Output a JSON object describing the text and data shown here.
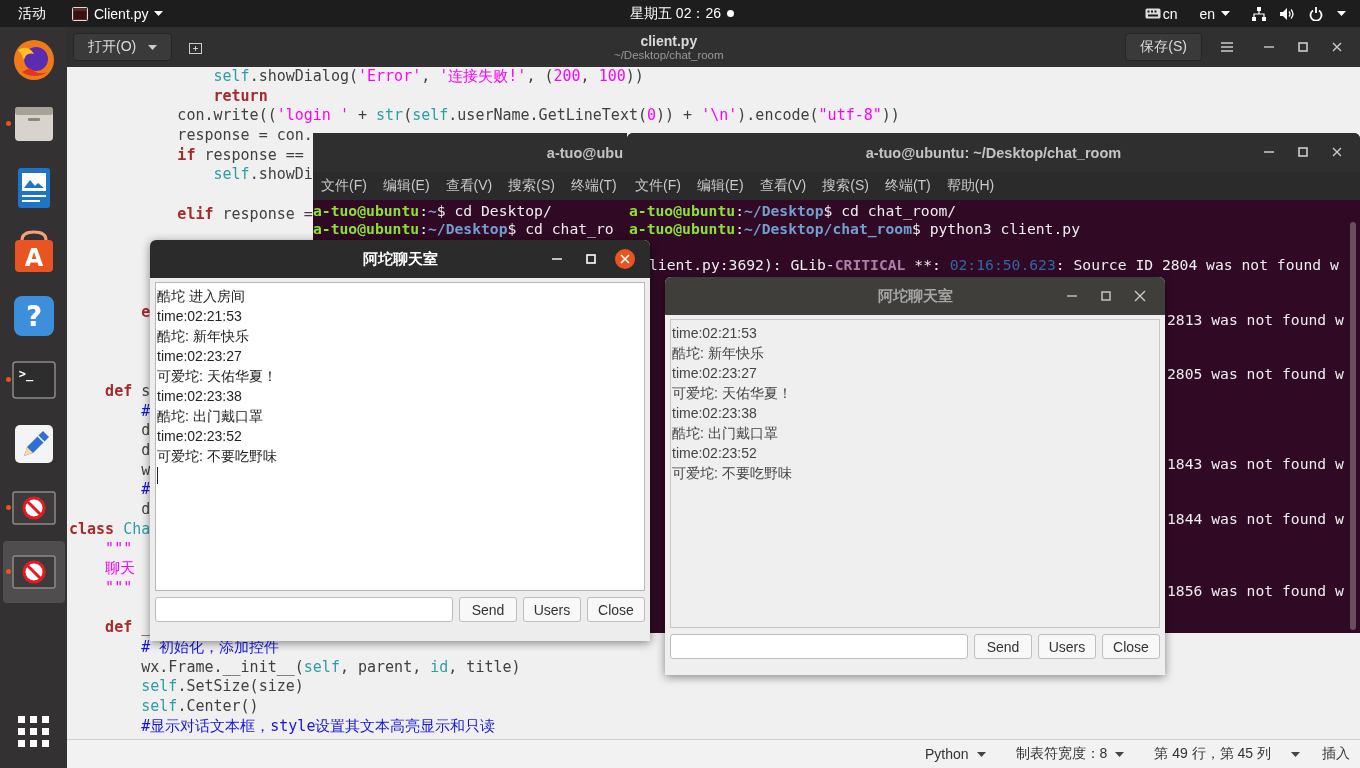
{
  "top_bar": {
    "activities": "活动",
    "app_menu": "Client.py",
    "clock": "星期五 02：26",
    "keyboard": "cn",
    "language": "en"
  },
  "dock": {
    "items": [
      {
        "kind": "browser",
        "running": false,
        "selected": false
      },
      {
        "kind": "files",
        "running": true,
        "selected": false
      },
      {
        "kind": "writer",
        "running": false,
        "selected": false
      },
      {
        "kind": "software",
        "glyph": "A",
        "running": false,
        "selected": false
      },
      {
        "kind": "help",
        "glyph": "?",
        "running": false,
        "selected": false
      },
      {
        "kind": "terminal",
        "glyph": ">_",
        "running": true,
        "selected": false
      },
      {
        "kind": "editor",
        "running": false,
        "selected": false
      },
      {
        "kind": "app",
        "running": true,
        "selected": false
      },
      {
        "kind": "app",
        "running": true,
        "selected": true
      }
    ]
  },
  "editor": {
    "open_button": "打开(O)",
    "title": "client.py",
    "subtitle": "~/Desktop/chat_room",
    "save_button": "保存(S)",
    "lines": [
      {
        "kind": "code",
        "segments": [
          {
            "kind": "self",
            "text": "                self"
          },
          {
            "kind": "plain",
            "text": ".showDialog("
          },
          {
            "kind": "str",
            "text": "'Error'"
          },
          {
            "kind": "plain",
            "text": ", "
          },
          {
            "kind": "str",
            "text": "'连接失败!'"
          },
          {
            "kind": "plain",
            "text": ", ("
          },
          {
            "kind": "num",
            "text": "200"
          },
          {
            "kind": "plain",
            "text": ", "
          },
          {
            "kind": "num",
            "text": "100"
          },
          {
            "kind": "plain",
            "text": "))"
          }
        ]
      },
      {
        "kind": "code",
        "segments": [
          {
            "kind": "kw",
            "text": "                return"
          }
        ]
      },
      {
        "kind": "code",
        "segments": [
          {
            "kind": "plain",
            "text": "            con.write(("
          },
          {
            "kind": "str",
            "text": "'login '"
          },
          {
            "kind": "plain",
            "text": " + "
          },
          {
            "kind": "builtin",
            "text": "str"
          },
          {
            "kind": "plain",
            "text": "("
          },
          {
            "kind": "self",
            "text": "self"
          },
          {
            "kind": "plain",
            "text": ".userName.GetLineText("
          },
          {
            "kind": "num",
            "text": "0"
          },
          {
            "kind": "plain",
            "text": ")) + "
          },
          {
            "kind": "str",
            "text": "'\\n'"
          },
          {
            "kind": "plain",
            "text": ").encode("
          },
          {
            "kind": "str",
            "text": "\"utf-8\""
          },
          {
            "kind": "plain",
            "text": "))"
          }
        ]
      },
      {
        "kind": "code",
        "segments": [
          {
            "kind": "plain",
            "text": "            response = con."
          }
        ]
      },
      {
        "kind": "code",
        "segments": [
          {
            "kind": "kw",
            "text": "            if"
          },
          {
            "kind": "plain",
            "text": " response =="
          }
        ]
      },
      {
        "kind": "code",
        "segments": [
          {
            "kind": "self",
            "text": "                self"
          },
          {
            "kind": "plain",
            "text": ".showDi"
          }
        ]
      },
      {
        "kind": "blank"
      },
      {
        "kind": "code",
        "segments": [
          {
            "kind": "kw",
            "text": "            elif"
          },
          {
            "kind": "plain",
            "text": " response ="
          }
        ]
      },
      {
        "kind": "blank"
      },
      {
        "kind": "blank"
      },
      {
        "kind": "blank"
      },
      {
        "kind": "blank"
      },
      {
        "kind": "code",
        "segments": [
          {
            "kind": "kw",
            "text": "        e"
          }
        ]
      },
      {
        "kind": "blank"
      },
      {
        "kind": "blank"
      },
      {
        "kind": "blank"
      },
      {
        "kind": "code",
        "segments": [
          {
            "kind": "kw",
            "text": "    def"
          },
          {
            "kind": "plain",
            "text": " s"
          }
        ]
      },
      {
        "kind": "code",
        "segments": [
          {
            "kind": "cmt",
            "text": "        #"
          }
        ]
      },
      {
        "kind": "code",
        "segments": [
          {
            "kind": "plain",
            "text": "        d"
          }
        ]
      },
      {
        "kind": "code",
        "segments": [
          {
            "kind": "plain",
            "text": "        d"
          }
        ]
      },
      {
        "kind": "code",
        "segments": [
          {
            "kind": "plain",
            "text": "        w"
          }
        ]
      },
      {
        "kind": "code",
        "segments": [
          {
            "kind": "cmt",
            "text": "        #"
          }
        ]
      },
      {
        "kind": "code",
        "segments": [
          {
            "kind": "plain",
            "text": "        d"
          }
        ]
      },
      {
        "kind": "code",
        "segments": [
          {
            "kind": "kw",
            "text": "class"
          },
          {
            "kind": "self",
            "text": " Cha"
          }
        ]
      },
      {
        "kind": "code",
        "segments": [
          {
            "kind": "str",
            "text": "    \"\"\""
          }
        ]
      },
      {
        "kind": "code",
        "segments": [
          {
            "kind": "str",
            "text": "    聊天"
          }
        ]
      },
      {
        "kind": "code",
        "segments": [
          {
            "kind": "str",
            "text": "    \"\"\""
          }
        ]
      },
      {
        "kind": "blank"
      },
      {
        "kind": "code",
        "segments": [
          {
            "kind": "kw",
            "text": "    def"
          },
          {
            "kind": "plain",
            "text": " _"
          }
        ]
      },
      {
        "kind": "code",
        "segments": [
          {
            "kind": "cmt",
            "text": "        # 初始化，添加控件"
          }
        ]
      },
      {
        "kind": "code",
        "segments": [
          {
            "kind": "plain",
            "text": "        wx.Frame.__init__("
          },
          {
            "kind": "self",
            "text": "self"
          },
          {
            "kind": "plain",
            "text": ", parent, "
          },
          {
            "kind": "builtin",
            "text": "id"
          },
          {
            "kind": "plain",
            "text": ", title)"
          }
        ]
      },
      {
        "kind": "code",
        "segments": [
          {
            "kind": "self",
            "text": "        self"
          },
          {
            "kind": "plain",
            "text": ".SetSize(size)"
          }
        ]
      },
      {
        "kind": "code",
        "segments": [
          {
            "kind": "self",
            "text": "        self"
          },
          {
            "kind": "plain",
            "text": ".Center()"
          }
        ]
      },
      {
        "kind": "code",
        "segments": [
          {
            "kind": "cmt",
            "text": "        #显示对话文本框，style设置其文本高亮显示和只读"
          }
        ]
      }
    ],
    "status_bar": {
      "language": "Python",
      "tab_width": "制表符宽度：8",
      "position": "第 49 行，第 45 列",
      "mode": "插入"
    }
  },
  "terminals": [
    {
      "kind": "covered",
      "title": "a-tuo@ubu",
      "menu": [
        "文件(F)",
        "编辑(E)",
        "查看(V)",
        "搜索(S)",
        "终端(T)"
      ],
      "lines": [
        {
          "kind": "full",
          "segments": [
            {
              "kind": "user",
              "text": "a-tuo@ubuntu"
            },
            {
              "kind": "plain",
              "text": ":"
            },
            {
              "kind": "path",
              "text": "~"
            },
            {
              "kind": "plain",
              "text": "$ cd Desktop/"
            }
          ]
        },
        {
          "kind": "full",
          "segments": [
            {
              "kind": "user",
              "text": "a-tuo@ubuntu"
            },
            {
              "kind": "plain",
              "text": ":"
            },
            {
              "kind": "path",
              "text": "~/Desktop"
            },
            {
              "kind": "plain",
              "text": "$ cd chat_ro"
            }
          ]
        }
      ]
    },
    {
      "kind": "full",
      "title": "a-tuo@ubuntu: ~/Desktop/chat_room",
      "menu": [
        "文件(F)",
        "编辑(E)",
        "查看(V)",
        "搜索(S)",
        "终端(T)",
        "帮助(H)"
      ],
      "lines": [
        {
          "kind": "full",
          "segments": [
            {
              "kind": "user",
              "text": "a-tuo@ubuntu"
            },
            {
              "kind": "plain",
              "text": ":"
            },
            {
              "kind": "path",
              "text": "~/Desktop"
            },
            {
              "kind": "plain",
              "text": "$ cd chat_room/"
            }
          ]
        },
        {
          "kind": "full",
          "segments": [
            {
              "kind": "user",
              "text": "a-tuo@ubuntu"
            },
            {
              "kind": "plain",
              "text": ":"
            },
            {
              "kind": "path",
              "text": "~/Desktop/chat_room"
            },
            {
              "kind": "plain",
              "text": "$ python3 client.py"
            }
          ]
        },
        {
          "kind": "blank"
        },
        {
          "kind": "after_dialog",
          "segments": [
            {
              "kind": "plain",
              "text": "lient.py:3692): GLib-"
            },
            {
              "kind": "crit",
              "text": "CRITICAL"
            },
            {
              "kind": "plain",
              "text": " **: "
            },
            {
              "kind": "time",
              "text": "02:16:50.623"
            },
            {
              "kind": "plain",
              "text": ": Source ID 2804 was not found w"
            }
          ]
        },
        {
          "kind": "blank"
        },
        {
          "kind": "blank"
        },
        {
          "kind": "tail",
          "segments": [
            {
              "kind": "plain",
              "text": "2813 was not found w"
            }
          ]
        },
        {
          "kind": "blank"
        },
        {
          "kind": "blank"
        },
        {
          "kind": "tail",
          "segments": [
            {
              "kind": "plain",
              "text": "2805 was not found w"
            }
          ]
        },
        {
          "kind": "blank"
        },
        {
          "kind": "blank"
        },
        {
          "kind": "blank"
        },
        {
          "kind": "blank"
        },
        {
          "kind": "tail",
          "segments": [
            {
              "kind": "plain",
              "text": "1843 was not found w"
            }
          ]
        },
        {
          "kind": "blank"
        },
        {
          "kind": "blank"
        },
        {
          "kind": "tail",
          "segments": [
            {
              "kind": "plain",
              "text": "1844 was not found w"
            }
          ]
        },
        {
          "kind": "blank"
        },
        {
          "kind": "blank"
        },
        {
          "kind": "blank"
        },
        {
          "kind": "tail",
          "segments": [
            {
              "kind": "plain",
              "text": "1856 was not found w"
            }
          ]
        }
      ]
    }
  ],
  "chat_windows": [
    {
      "title": "阿坨聊天室",
      "focused": true,
      "cursor": true,
      "messages": [
        "酷坨 进入房间",
        "time:02:21:53",
        "酷坨: 新年快乐",
        "time:02:23:27",
        "可爱坨: 天佑华夏！",
        "time:02:23:38",
        "酷坨: 出门戴口罩",
        "time:02:23:52",
        "可爱坨: 不要吃野味"
      ],
      "buttons": [
        "Send",
        "Users",
        "Close"
      ]
    },
    {
      "title": "阿坨聊天室",
      "focused": false,
      "cursor": false,
      "messages": [
        "time:02:21:53",
        "酷坨: 新年快乐",
        "time:02:23:27",
        "可爱坨: 天佑华夏！",
        "time:02:23:38",
        "酷坨: 出门戴口罩",
        "time:02:23:52",
        "可爱坨: 不要吃野味"
      ],
      "buttons": [
        "Send",
        "Users",
        "Close"
      ]
    }
  ]
}
